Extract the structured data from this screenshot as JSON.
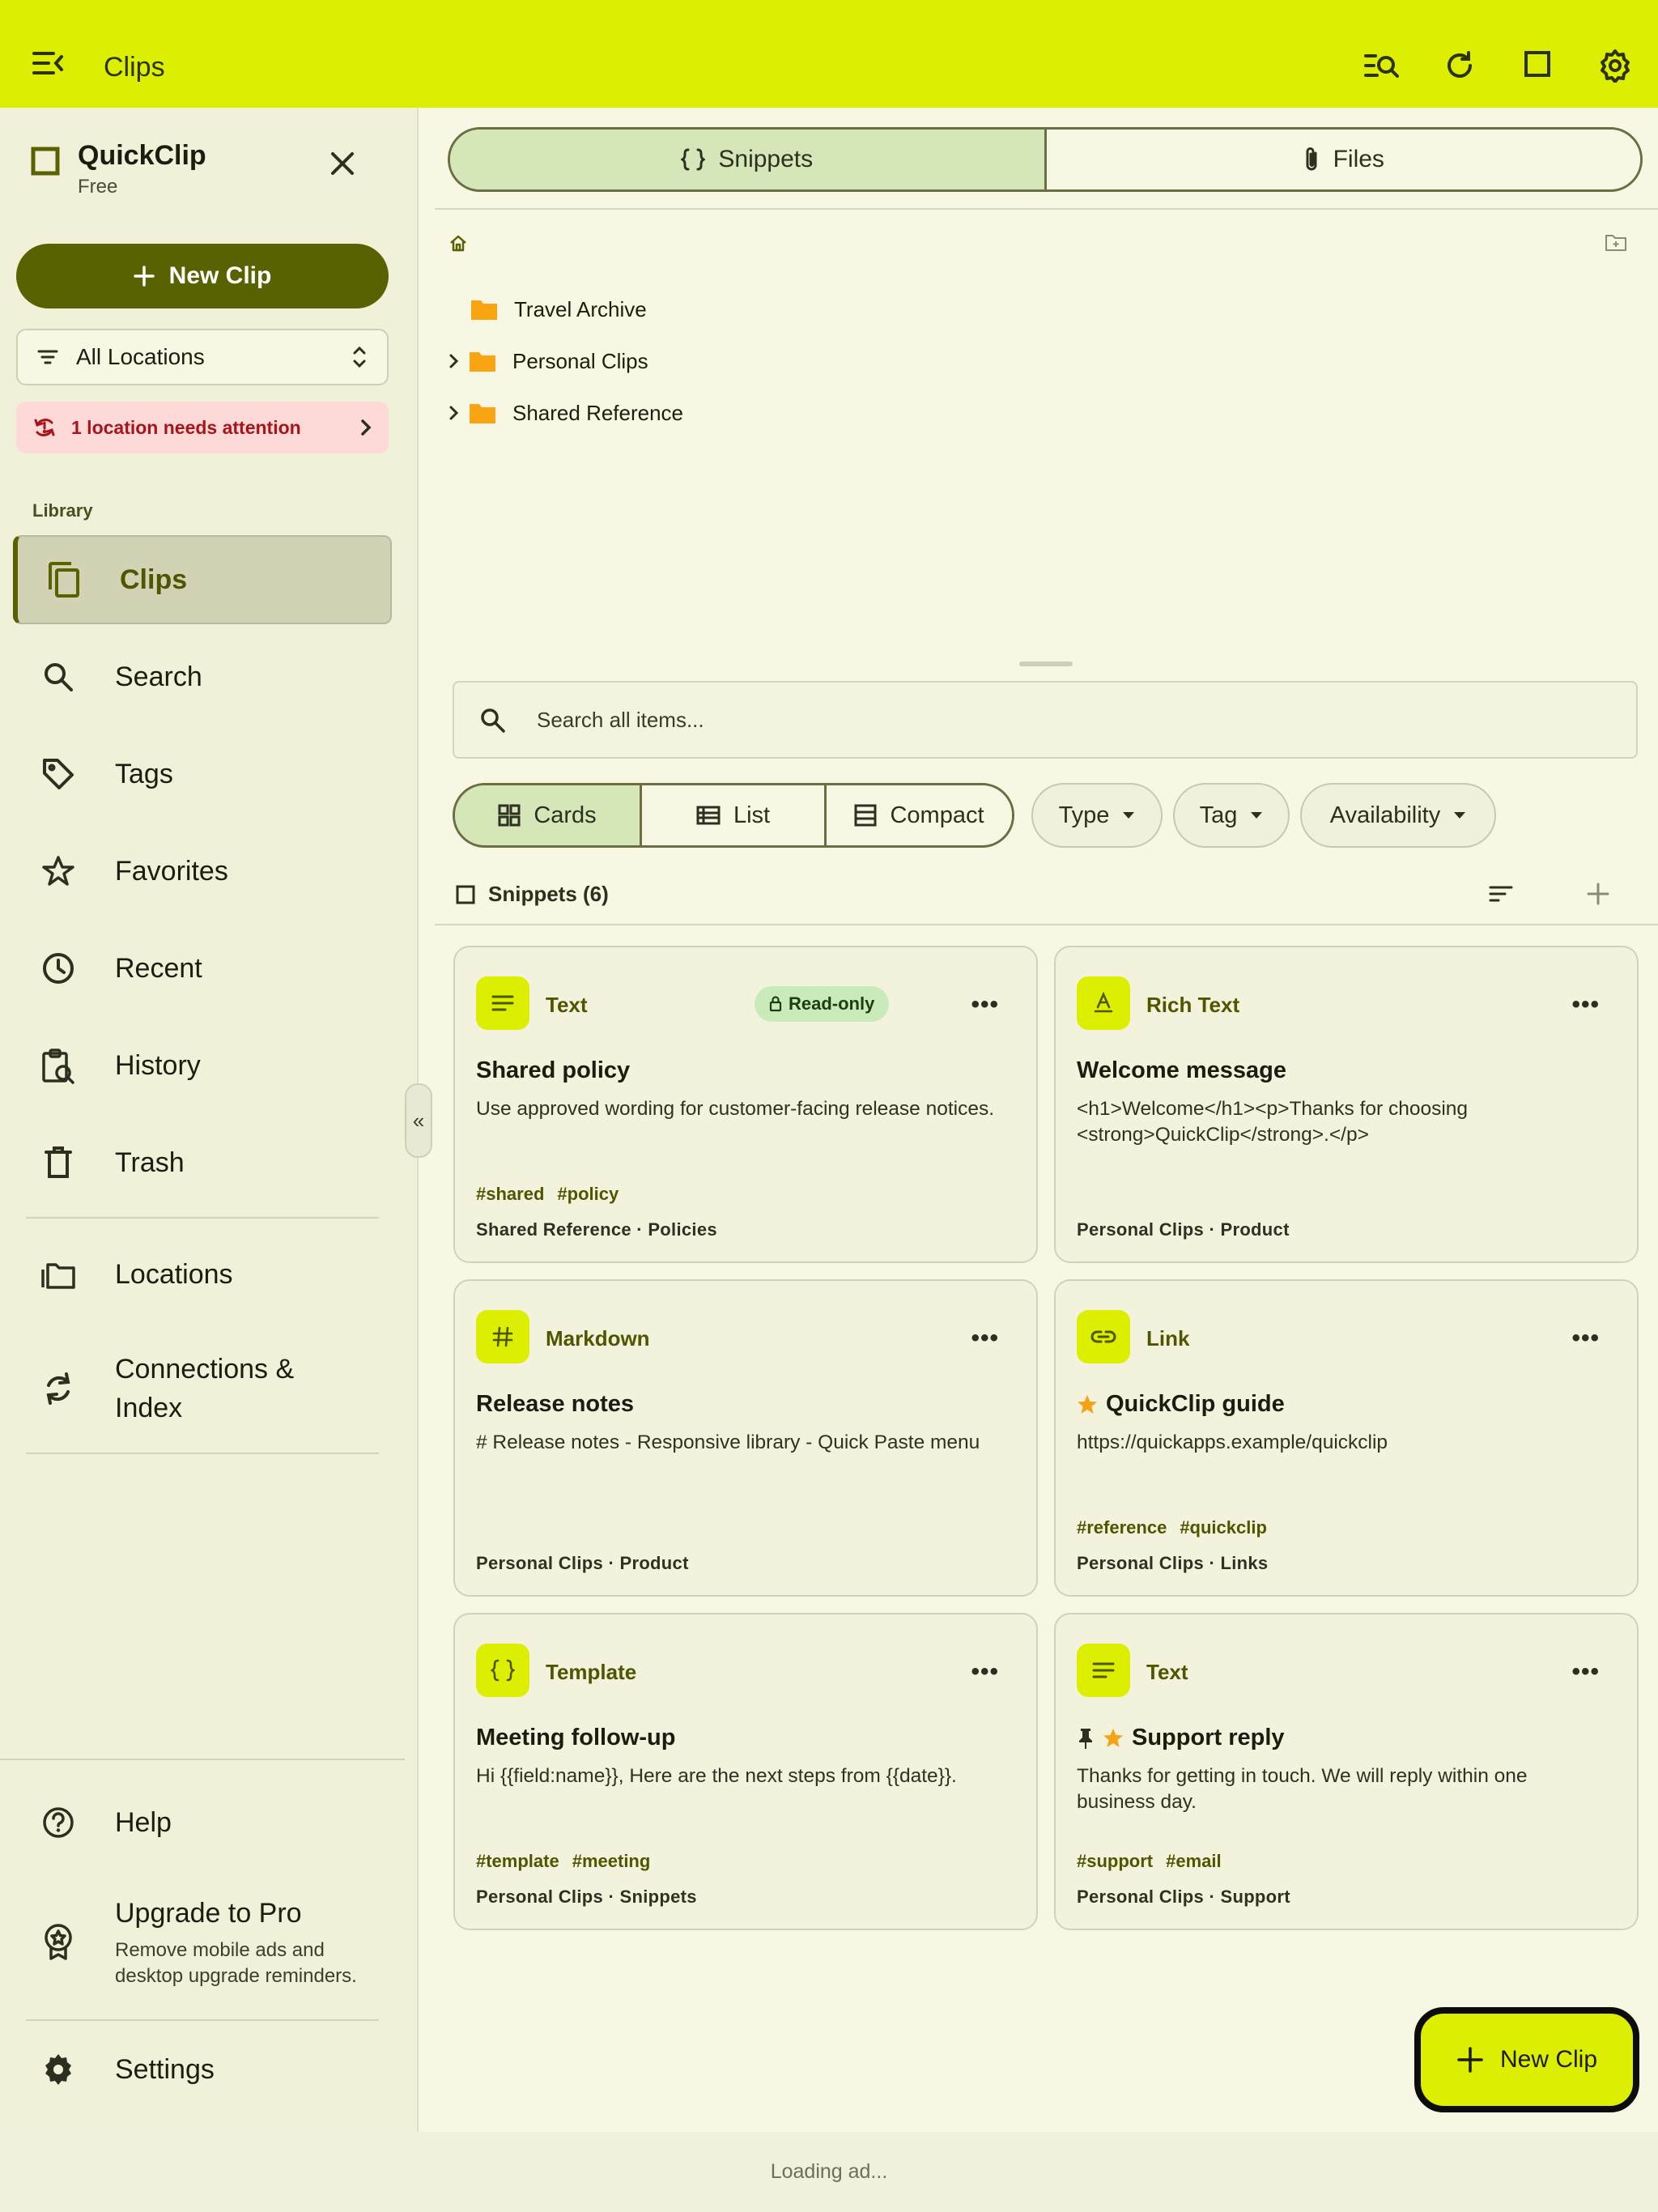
{
  "colors": {
    "accent": "#dcef00",
    "brand_dark": "#586200",
    "star": "#f4a316",
    "folder": "#f9a411"
  },
  "topbar": {
    "title": "Clips",
    "icons": [
      "menu-open-icon",
      "search-list-icon",
      "refresh-icon",
      "square-icon",
      "gear-icon"
    ]
  },
  "sidebar": {
    "brand_name": "QuickClip",
    "brand_plan": "Free",
    "new_clip_label": "New Clip",
    "location_filter": "All Locations",
    "attention_text": "1 location needs attention",
    "section_label": "Library",
    "items": [
      {
        "label": "Clips",
        "icon": "copy-icon"
      },
      {
        "label": "Search",
        "icon": "search-icon"
      },
      {
        "label": "Tags",
        "icon": "tag-icon"
      },
      {
        "label": "Favorites",
        "icon": "star-icon"
      },
      {
        "label": "Recent",
        "icon": "clock-icon"
      },
      {
        "label": "History",
        "icon": "history-icon"
      },
      {
        "label": "Trash",
        "icon": "trash-icon"
      },
      {
        "label": "Locations",
        "icon": "folders-icon"
      },
      {
        "label": "Connections & Index",
        "icon": "sync-icon"
      }
    ],
    "help": "Help",
    "upgrade_title": "Upgrade to Pro",
    "upgrade_sub": "Remove mobile ads and desktop upgrade reminders.",
    "settings": "Settings"
  },
  "main": {
    "tabs": [
      {
        "label": "Snippets"
      },
      {
        "label": "Files"
      }
    ],
    "folders": [
      {
        "label": "Travel Archive",
        "expandable": false
      },
      {
        "label": "Personal Clips",
        "expandable": true
      },
      {
        "label": "Shared Reference",
        "expandable": true
      }
    ],
    "search_placeholder": "Search all items...",
    "views": [
      {
        "label": "Cards"
      },
      {
        "label": "List"
      },
      {
        "label": "Compact"
      }
    ],
    "filters": [
      {
        "label": "Type"
      },
      {
        "label": "Tag"
      },
      {
        "label": "Availability"
      }
    ],
    "list_title": "Snippets (6)",
    "cards": [
      {
        "type": "Text",
        "badge": "Read-only",
        "title": "Shared policy",
        "body": "Use approved wording for customer-facing release notices.",
        "tags": [
          "#shared",
          "#policy"
        ],
        "path": "Shared Reference · Policies"
      },
      {
        "type": "Rich Text",
        "title": "Welcome message",
        "body": "<h1>Welcome</h1><p>Thanks for choosing <strong>QuickClip</strong>.</p>",
        "tags": [],
        "path": "Personal Clips · Product"
      },
      {
        "type": "Markdown",
        "title": "Release notes",
        "body": "# Release notes - Responsive library - Quick Paste menu",
        "tags": [],
        "path": "Personal Clips · Product"
      },
      {
        "type": "Link",
        "title": "QuickClip guide",
        "body": "https://quickapps.example/quickclip",
        "tags": [
          "#reference",
          "#quickclip"
        ],
        "path": "Personal Clips · Links"
      },
      {
        "type": "Template",
        "title": "Meeting follow-up",
        "body": "Hi {{field:name}}, Here are the next steps from {{date}}.",
        "tags": [
          "#template",
          "#meeting"
        ],
        "path": "Personal Clips · Snippets"
      },
      {
        "type": "Text",
        "title": "Support reply",
        "body": "Thanks for getting in touch. We will reply within one business day.",
        "tags": [
          "#support",
          "#email"
        ],
        "path": "Personal Clips · Support"
      }
    ],
    "more_label": "•••",
    "fab_label": "New Clip"
  },
  "ad_text": "Loading ad..."
}
